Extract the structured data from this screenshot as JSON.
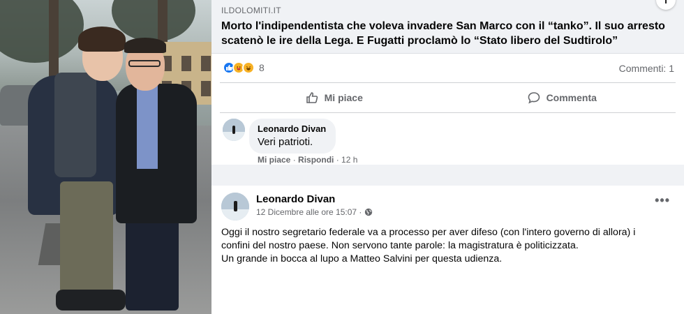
{
  "post": {
    "link_source": "ILDOLOMITI.IT",
    "link_title": "Morto l'indipendentista che voleva invadere San Marco con il “tanko”. Il suo arresto scatenò le ire della Lega. E Fugatti proclamò lo “Stato libero del Sudtirolo”",
    "reaction_count": "8",
    "comment_count": "Commenti: 1",
    "like_label": "Mi piace",
    "comment_label": "Commenta"
  },
  "comment": {
    "author": "Leonardo Divan",
    "text": "Veri patrioti.",
    "like_action": "Mi piace",
    "reply_action": "Rispondi",
    "time": "12 h"
  },
  "post2": {
    "author": "Leonardo Divan",
    "timestamp": "12 Dicembre alle ore 15:07 ·",
    "body_lines": [
      "Oggi il nostro segretario federale va a processo per aver difeso (con l'intero governo di allora) i",
      "confini del nostro paese. Non servono tante parole: la magistratura è politicizzata.",
      "Un grande in bocca al lupo a Matteo Salvini per questa udienza."
    ],
    "more_icon": "more-icon"
  },
  "icons": {
    "like": "thumbs-up-icon",
    "comment": "comment-bubble-icon",
    "globe": "globe-icon",
    "reactions": [
      "like-reaction-icon",
      "care-reaction-icon",
      "haha-reaction-icon"
    ]
  },
  "colors": {
    "facebook_blue": "#1877f2",
    "secondary_text": "#65676b",
    "bubble_bg": "#f0f2f5"
  }
}
